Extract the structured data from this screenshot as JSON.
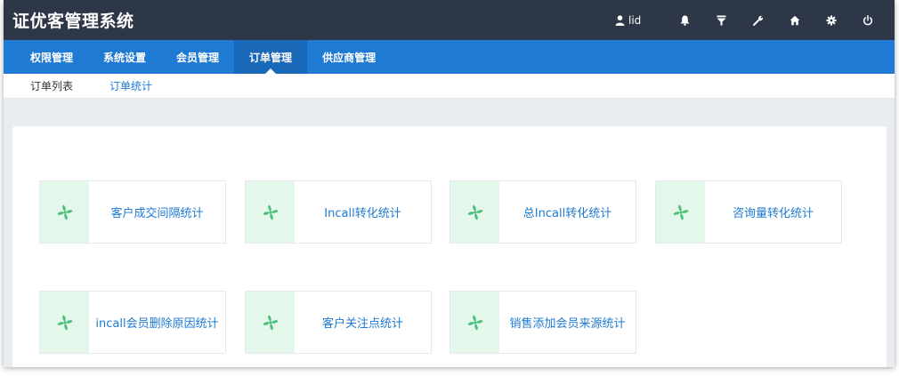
{
  "app": {
    "title": "证优客管理系统"
  },
  "topbar": {
    "user_name": "lid",
    "icons": [
      "user-icon",
      "bell-icon",
      "filter-icon",
      "wrench-icon",
      "home-icon",
      "gear-icon",
      "power-icon"
    ]
  },
  "nav": {
    "items": [
      {
        "label": "权限管理"
      },
      {
        "label": "系统设置"
      },
      {
        "label": "会员管理"
      },
      {
        "label": "订单管理",
        "active": true
      },
      {
        "label": "供应商管理"
      }
    ]
  },
  "subnav": {
    "items": [
      {
        "label": "订单列表"
      },
      {
        "label": "订单统计",
        "active": true
      }
    ]
  },
  "cards": [
    {
      "label": "客户成交间隔统计",
      "icon": "pinwheel-icon"
    },
    {
      "label": "Incall转化统计",
      "icon": "pinwheel-icon"
    },
    {
      "label": "总Incall转化统计",
      "icon": "pinwheel-icon"
    },
    {
      "label": "咨询量转化统计",
      "icon": "pinwheel-icon"
    },
    {
      "label": "incall会员删除原因统计",
      "icon": "pinwheel-icon"
    },
    {
      "label": "客户关注点统计",
      "icon": "pinwheel-icon"
    },
    {
      "label": "销售添加会员来源统计",
      "icon": "pinwheel-icon"
    }
  ],
  "colors": {
    "topbar": "#2d3748",
    "nav": "#1e7ad2",
    "accent": "#1e7ad2",
    "card_icon_bg": "#e3f8ea",
    "icon_green": "#4cc07a"
  }
}
